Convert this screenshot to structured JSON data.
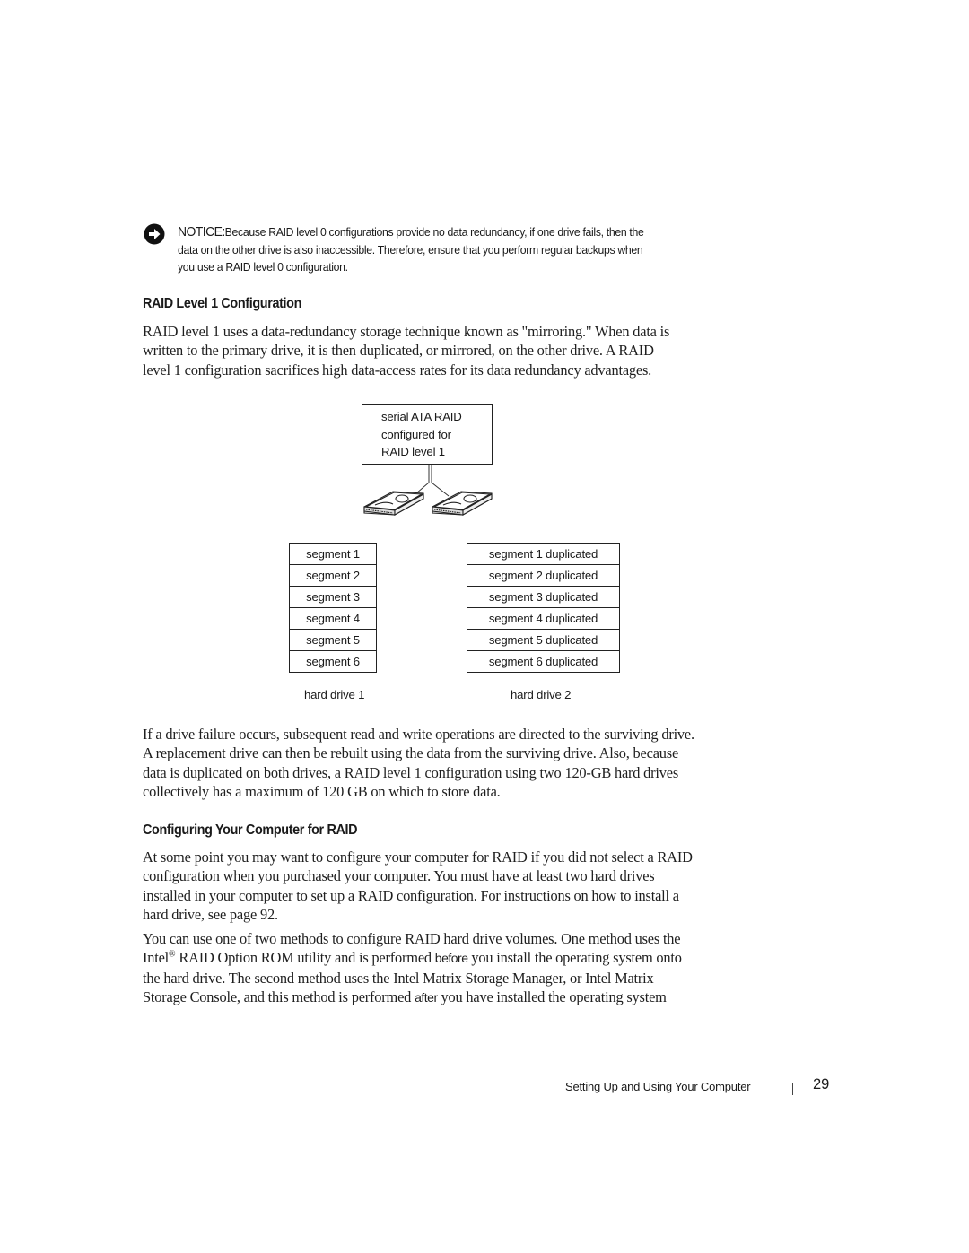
{
  "notice": {
    "icon": "arrow-right-circle-icon",
    "label": "NOTICE:",
    "lines": [
      "Because RAID level 0 configurations provide no data redundancy, if one drive fails, then the",
      "data on the other drive is also inaccessible. Therefore, ensure that you perform regular backups when",
      "you use a RAID level 0 configuration."
    ]
  },
  "section1": {
    "heading": "RAID Level 1 Configuration",
    "paragraph_lines": [
      "RAID level 1 uses a data-redundancy storage technique known as \"mirroring.\" When data is",
      "written to the primary drive, it is then duplicated, or mirrored, on the other drive. A RAID",
      "level 1 configuration sacrifices high data-access rates for its data redundancy advantages."
    ]
  },
  "diagram": {
    "controller_lines": [
      "serial ATA RAID",
      "configured for",
      "RAID level 1"
    ],
    "drive1": {
      "label": "hard drive 1",
      "segments": [
        "segment 1",
        "segment 2",
        "segment 3",
        "segment 4",
        "segment 5",
        "segment 6"
      ]
    },
    "drive2": {
      "label": "hard drive 2",
      "segments": [
        "segment 1 duplicated",
        "segment 2 duplicated",
        "segment 3 duplicated",
        "segment 4 duplicated",
        "segment 5 duplicated",
        "segment 6 duplicated"
      ]
    }
  },
  "paragraph2_lines": [
    "If a drive failure occurs, subsequent read and write operations are directed to the surviving drive.",
    "A replacement drive can then be rebuilt using the data from the surviving drive. Also, because",
    "data is duplicated on both drives, a RAID level 1 configuration using two 120-GB hard drives",
    "collectively has a maximum of 120 GB on which to store data."
  ],
  "section2": {
    "heading": "Configuring Your Computer for RAID",
    "paragraph1_lines": [
      "At some point you may want to configure your computer for RAID if you did not select a RAID",
      "configuration when you purchased your computer. You must have at least two hard drives",
      "installed in your computer to set up a RAID configuration. For instructions on how to install a",
      "hard drive, see page 92."
    ],
    "paragraph2": {
      "line1": "You can use one of two methods to configure RAID hard drive volumes. One method uses the",
      "line2_a": "Intel",
      "line2_sup": "®",
      "line2_b": " RAID Option ROM utility and is performed ",
      "line2_em": "before",
      "line2_c": " you install the operating system onto",
      "line3": "the hard drive. The second method uses the Intel Matrix Storage Manager, or Intel Matrix",
      "line4_a": "Storage Console, and this method is performed ",
      "line4_em": "after",
      "line4_b": " you have installed the operating system"
    }
  },
  "footer": {
    "chapter_title": "Setting Up and Using Your Computer",
    "page_number": "29"
  }
}
